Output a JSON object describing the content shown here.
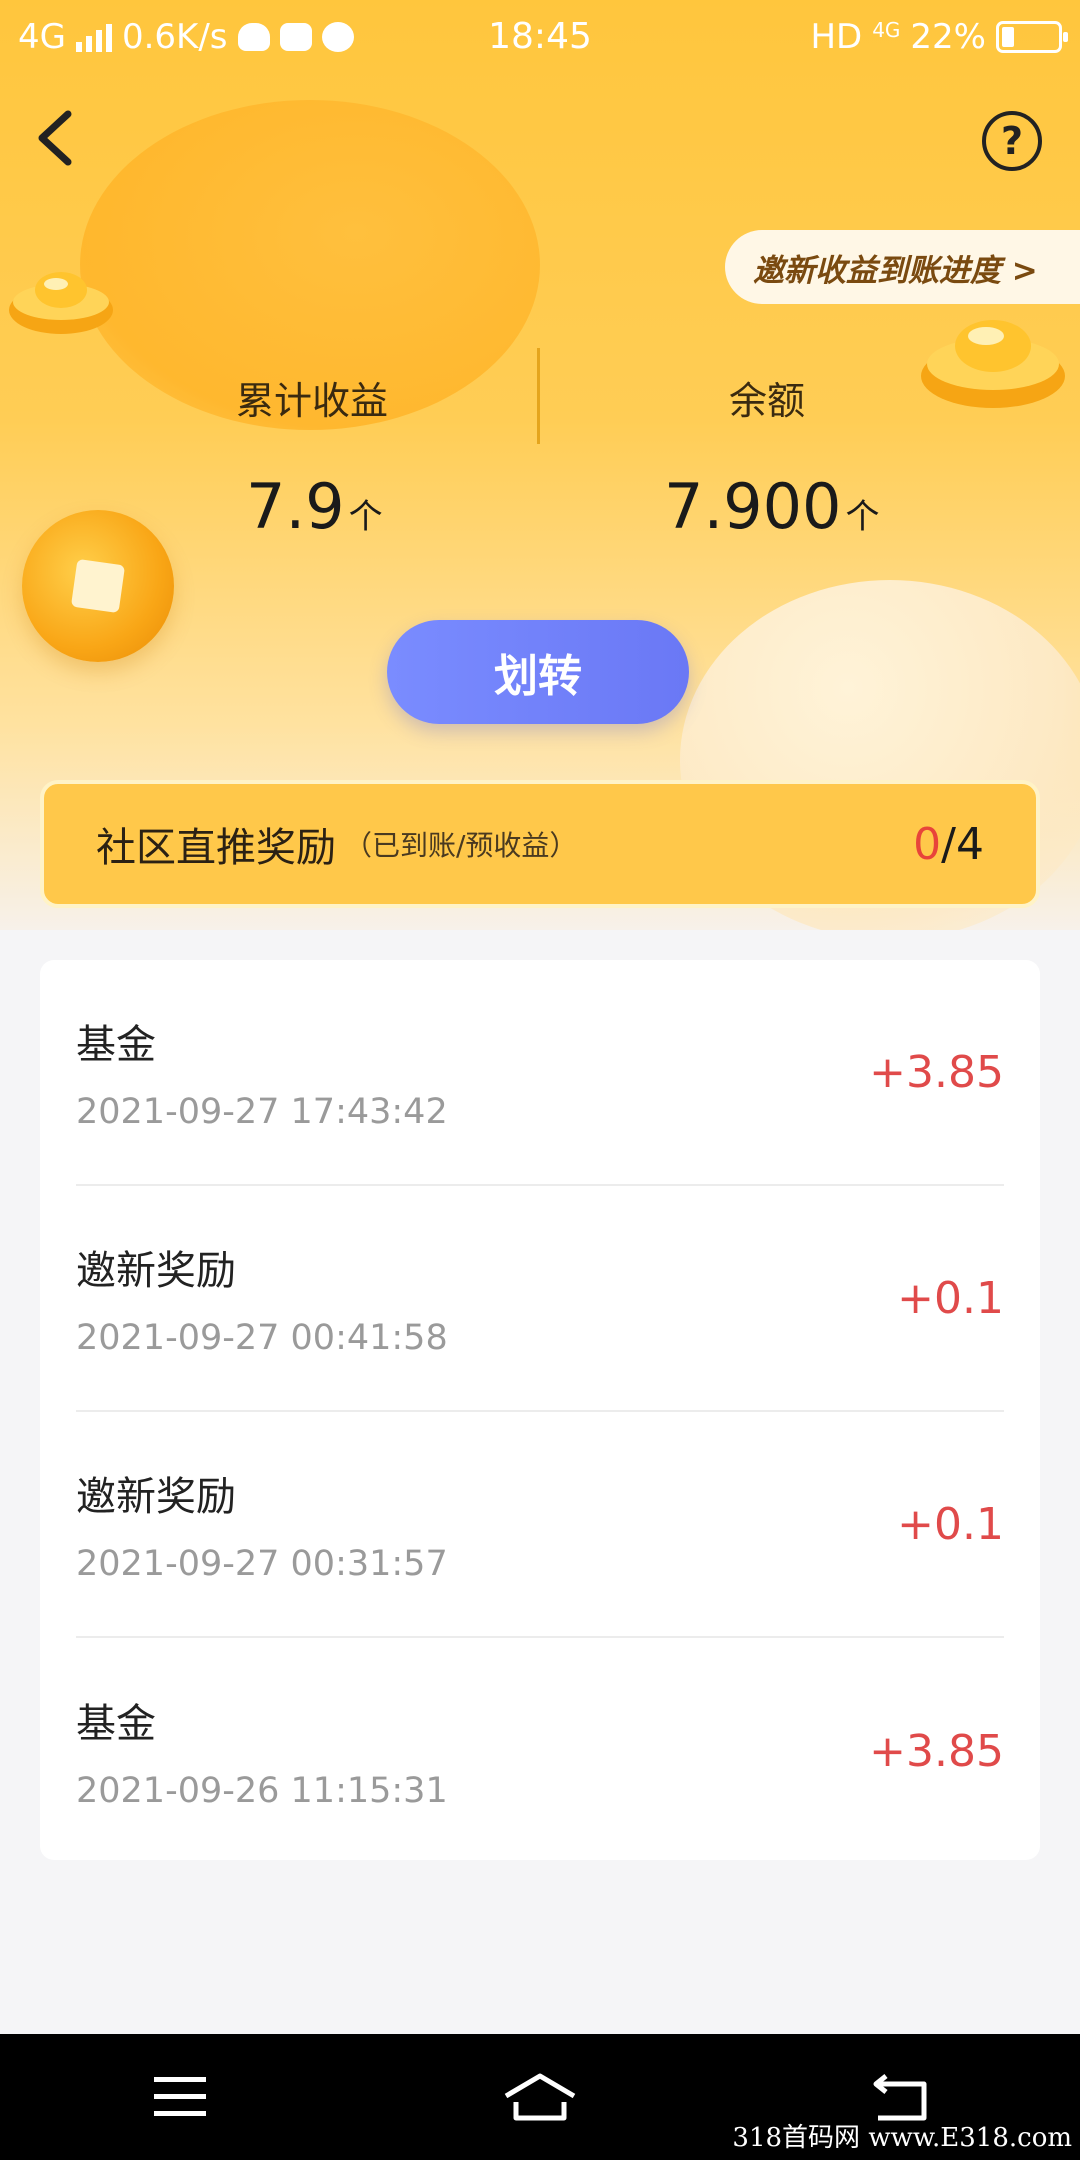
{
  "status_bar": {
    "network": "4G",
    "speed": "0.6K/s",
    "time": "18:45",
    "hd": "HD",
    "hd_network": "4G",
    "battery": "22%",
    "battery_level": 0.22
  },
  "nav": {
    "back_icon": "chevron-left-icon",
    "help_label": "?"
  },
  "progress_link": "邀新收益到账进度 >",
  "stats": {
    "cumulative_label": "累计收益",
    "cumulative_value": "7.9",
    "cumulative_unit": "个",
    "balance_label": "余额",
    "balance_value": "7.900",
    "balance_unit": "个"
  },
  "transfer_button": "划转",
  "reward": {
    "title": "社区直推奖励",
    "subtitle": "（已到账/预收益）",
    "arrived": "0",
    "separator": "/",
    "expected": "4"
  },
  "records": [
    {
      "name": "基金",
      "time": "2021-09-27 17:43:42",
      "amount": "+3.85"
    },
    {
      "name": "邀新奖励",
      "time": "2021-09-27 00:41:58",
      "amount": "+0.1"
    },
    {
      "name": "邀新奖励",
      "time": "2021-09-27 00:31:57",
      "amount": "+0.1"
    },
    {
      "name": "基金",
      "time": "2021-09-26 11:15:31",
      "amount": "+3.85"
    }
  ],
  "watermark": "318首码网 www.E318.com",
  "colors": {
    "accent_yellow": "#ffc63d",
    "button_blue": "#6a78f5",
    "amount_red": "#e04a4a"
  }
}
